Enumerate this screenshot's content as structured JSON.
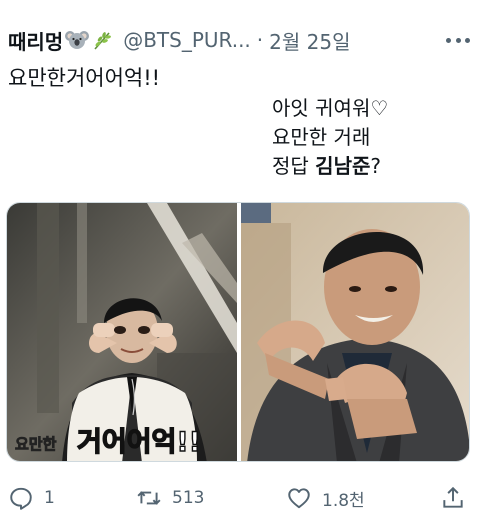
{
  "tweet": {
    "display_name": "때리멍",
    "emoji_koala": "koala-emoji",
    "emoji_herb": "herb-emoji",
    "handle": "@BTS_PUR...",
    "separator": "·",
    "date": "2월 25일",
    "text_line1": "요만한거어어억!!",
    "text_lines": [
      "아잇 귀여워♡",
      "요만한 거래"
    ],
    "answer_prefix": "정답 ",
    "answer_bold": "김남준",
    "answer_suffix": "?",
    "caption_overlay": {
      "small": "요만한",
      "large": "거어어억!!"
    }
  },
  "actions": {
    "reply_count": "1",
    "retweet_count": "513",
    "like_count": "1.8천",
    "icons": [
      "reply-icon",
      "retweet-icon",
      "like-icon",
      "share-icon"
    ]
  },
  "colors": {
    "text": "#0f1419",
    "secondary": "#536471",
    "border": "#cfd9de"
  }
}
